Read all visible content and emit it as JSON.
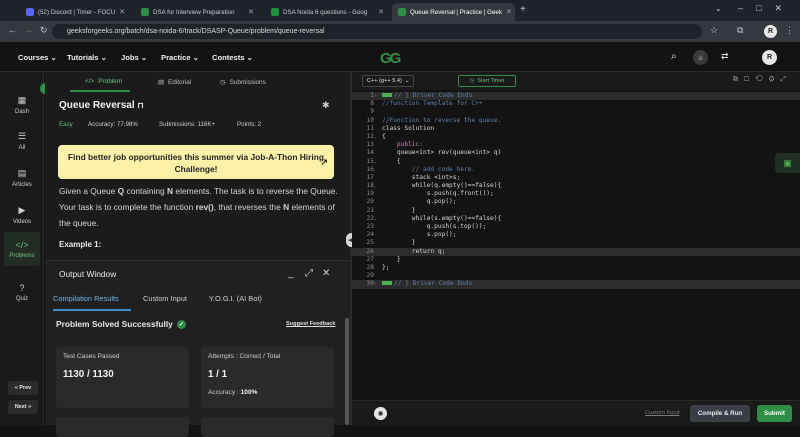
{
  "browser": {
    "tabs": [
      {
        "label": "(52) Discord | Timer - FOCU",
        "icon_color": "#5865f2"
      },
      {
        "label": "DSA for Interview Preparation",
        "icon_color": "#2f8d46"
      },
      {
        "label": "DSA Noida 6 questions - Goog",
        "icon_color": "#1e8e3e"
      },
      {
        "label": "Queue Reversal | Practice | Geek",
        "icon_color": "#2f8d46"
      }
    ],
    "url": "geeksforgeeks.org/batch/dsa-noida-6/track/DSASP-Queue/problem/queue-reversal",
    "profile_initial": "R"
  },
  "site": {
    "logo": "GG",
    "menu": [
      "Courses",
      "Tutorials",
      "Jobs",
      "Practice",
      "Contests"
    ]
  },
  "rail": {
    "items": [
      "Dash",
      "All",
      "Articles",
      "Videos",
      "Problems",
      "Quiz"
    ],
    "prev": "« Prev",
    "next": "Next »"
  },
  "problem": {
    "tabs": [
      "Problem",
      "Editorial",
      "Submissions"
    ],
    "title": "Queue Reversal",
    "difficulty": "Easy",
    "accuracy": "Accuracy: 77.98%",
    "submissions": "Submissions: 116K+",
    "points": "Points: 2",
    "banner": "Find better job opportunities this summer via Job-A-Thon Hiring Challenge!",
    "description_parts": [
      "Given a Queue ",
      "Q",
      " containing ",
      "N",
      " elements. The task is to reverse the Queue. Your task is to complete the function ",
      "rev()",
      ", that reverses the ",
      "N",
      " elements of the queue."
    ],
    "example_heading": "Example 1:"
  },
  "output": {
    "title": "Output Window",
    "tabs": [
      "Compilation Results",
      "Custom Input",
      "Y.O.G.I. (AI Bot)"
    ],
    "status": "Problem Solved Successfully",
    "feedback": "Suggest Feedback",
    "cards": [
      {
        "label": "Test Cases Passed",
        "value": "1130 / 1130",
        "sub_label": "",
        "sub_value": ""
      },
      {
        "label": "Attempts : Correct / Total",
        "value": "1 / 1",
        "sub_label": "Accuracy : ",
        "sub_value": "100%"
      }
    ]
  },
  "editor": {
    "language": "C++ (g++ 5.4)",
    "timer": "Start Timer",
    "lines": [
      {
        "n": "1",
        "text": "// } Driver Code Ends",
        "fold": ">",
        "hl": true,
        "cls": "cm",
        "marker": true
      },
      {
        "n": "8",
        "text": "//function Template for C++",
        "cls": "cm"
      },
      {
        "n": "9",
        "text": ""
      },
      {
        "n": "10",
        "text": "//Function to reverse the queue.",
        "cls": "cm"
      },
      {
        "n": "11",
        "text": "class Solution"
      },
      {
        "n": "12",
        "text": "{",
        "fold": "v"
      },
      {
        "n": "13",
        "text": "    public:",
        "cls": "kw"
      },
      {
        "n": "14",
        "text": "    queue<int> rev(queue<int> q)"
      },
      {
        "n": "15",
        "text": "    {",
        "fold": "v"
      },
      {
        "n": "16",
        "text": "        // add code here.",
        "cls": "cm"
      },
      {
        "n": "17",
        "text": "        stack <int>s;"
      },
      {
        "n": "18",
        "text": "        while(q.empty()==false){",
        "fold": "v"
      },
      {
        "n": "19",
        "text": "            s.push(q.front());"
      },
      {
        "n": "20",
        "text": "            q.pop();"
      },
      {
        "n": "21",
        "text": "        }"
      },
      {
        "n": "22",
        "text": "        while(s.empty()==false){",
        "fold": "v"
      },
      {
        "n": "23",
        "text": "            q.push(s.top());"
      },
      {
        "n": "24",
        "text": "            s.pop();"
      },
      {
        "n": "25",
        "text": "        }"
      },
      {
        "n": "26",
        "text": "        return q;",
        "hl": true
      },
      {
        "n": "27",
        "text": "    }"
      },
      {
        "n": "28",
        "text": "};"
      },
      {
        "n": "29",
        "text": ""
      },
      {
        "n": "30",
        "text": "// } Driver Code Ends",
        "fold": ">",
        "hl": true,
        "cls": "cm",
        "marker": true
      }
    ],
    "custom_input": "Custom Input",
    "compile_run": "Compile & Run",
    "submit": "Submit"
  },
  "colors": {
    "brand": "#2f8d46",
    "banner": "#fdf1a8",
    "link_tab": "#6fb4e8"
  }
}
